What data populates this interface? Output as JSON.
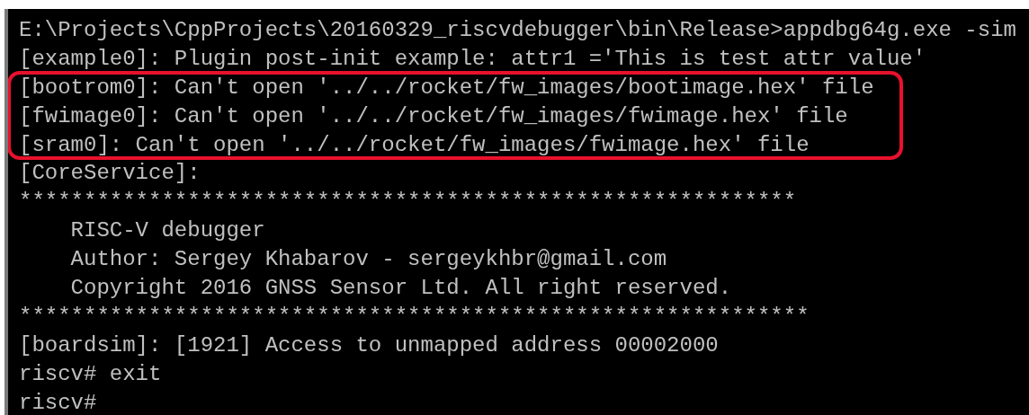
{
  "console": {
    "blocks": [
      {
        "highlighted": false,
        "lines": [
          "E:\\Projects\\CppProjects\\20160329_riscvdebugger\\bin\\Release>appdbg64g.exe -sim",
          "[example0]: Plugin post-init example: attr1 ='This is test attr value'"
        ]
      },
      {
        "highlighted": true,
        "lines": [
          "[bootrom0]: Can't open '../../rocket/fw_images/bootimage.hex' file",
          "[fwimage0]: Can't open '../../rocket/fw_images/fwimage.hex' file",
          "[sram0]: Can't open '../../rocket/fw_images/fwimage.hex' file"
        ]
      },
      {
        "highlighted": false,
        "lines": [
          "[CoreService]:",
          "************************************************************",
          "    RISC-V debugger",
          "    Author: Sergey Khabarov - sergeykhbr@gmail.com",
          "    Copyright 2016 GNSS Sensor Ltd. All right reserved.",
          "*************************************************************",
          "[boardsim]: [1921] Access to unmapped address 00002000",
          "riscv# exit",
          "riscv#"
        ]
      }
    ]
  }
}
